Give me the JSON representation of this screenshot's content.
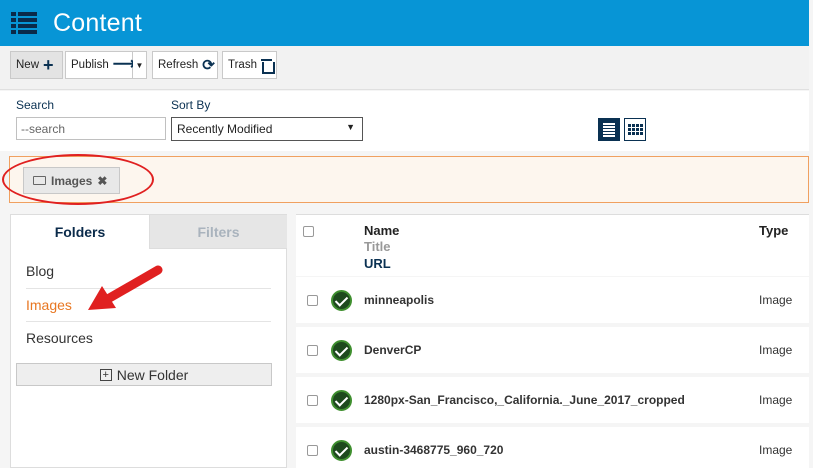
{
  "header": {
    "title": "Content"
  },
  "toolbar": {
    "new_label": "New",
    "publish_label": "Publish",
    "refresh_label": "Refresh",
    "trash_label": "Trash"
  },
  "search": {
    "label": "Search",
    "placeholder": "--search"
  },
  "sort": {
    "label": "Sort By",
    "selected": "Recently Modified"
  },
  "tag": {
    "label": "Images",
    "close": "✖"
  },
  "left_panel": {
    "tabs": [
      "Folders",
      "Filters"
    ],
    "folders": [
      {
        "label": "Blog"
      },
      {
        "label": "Images"
      },
      {
        "label": "Resources"
      }
    ],
    "new_folder_label": "New Folder"
  },
  "list": {
    "columns": {
      "name": "Name",
      "title": "Title",
      "url": "URL",
      "type": "Type"
    },
    "rows": [
      {
        "name": "minneapolis",
        "type": "Image"
      },
      {
        "name": "DenverCP",
        "type": "Image"
      },
      {
        "name": "1280px-San_Francisco,_California._June_2017_cropped",
        "type": "Image"
      },
      {
        "name": "austin-3468775_960_720",
        "type": "Image"
      }
    ]
  },
  "colors": {
    "header": "#0795d6",
    "accent": "#e87722",
    "annotation": "#e02020"
  }
}
